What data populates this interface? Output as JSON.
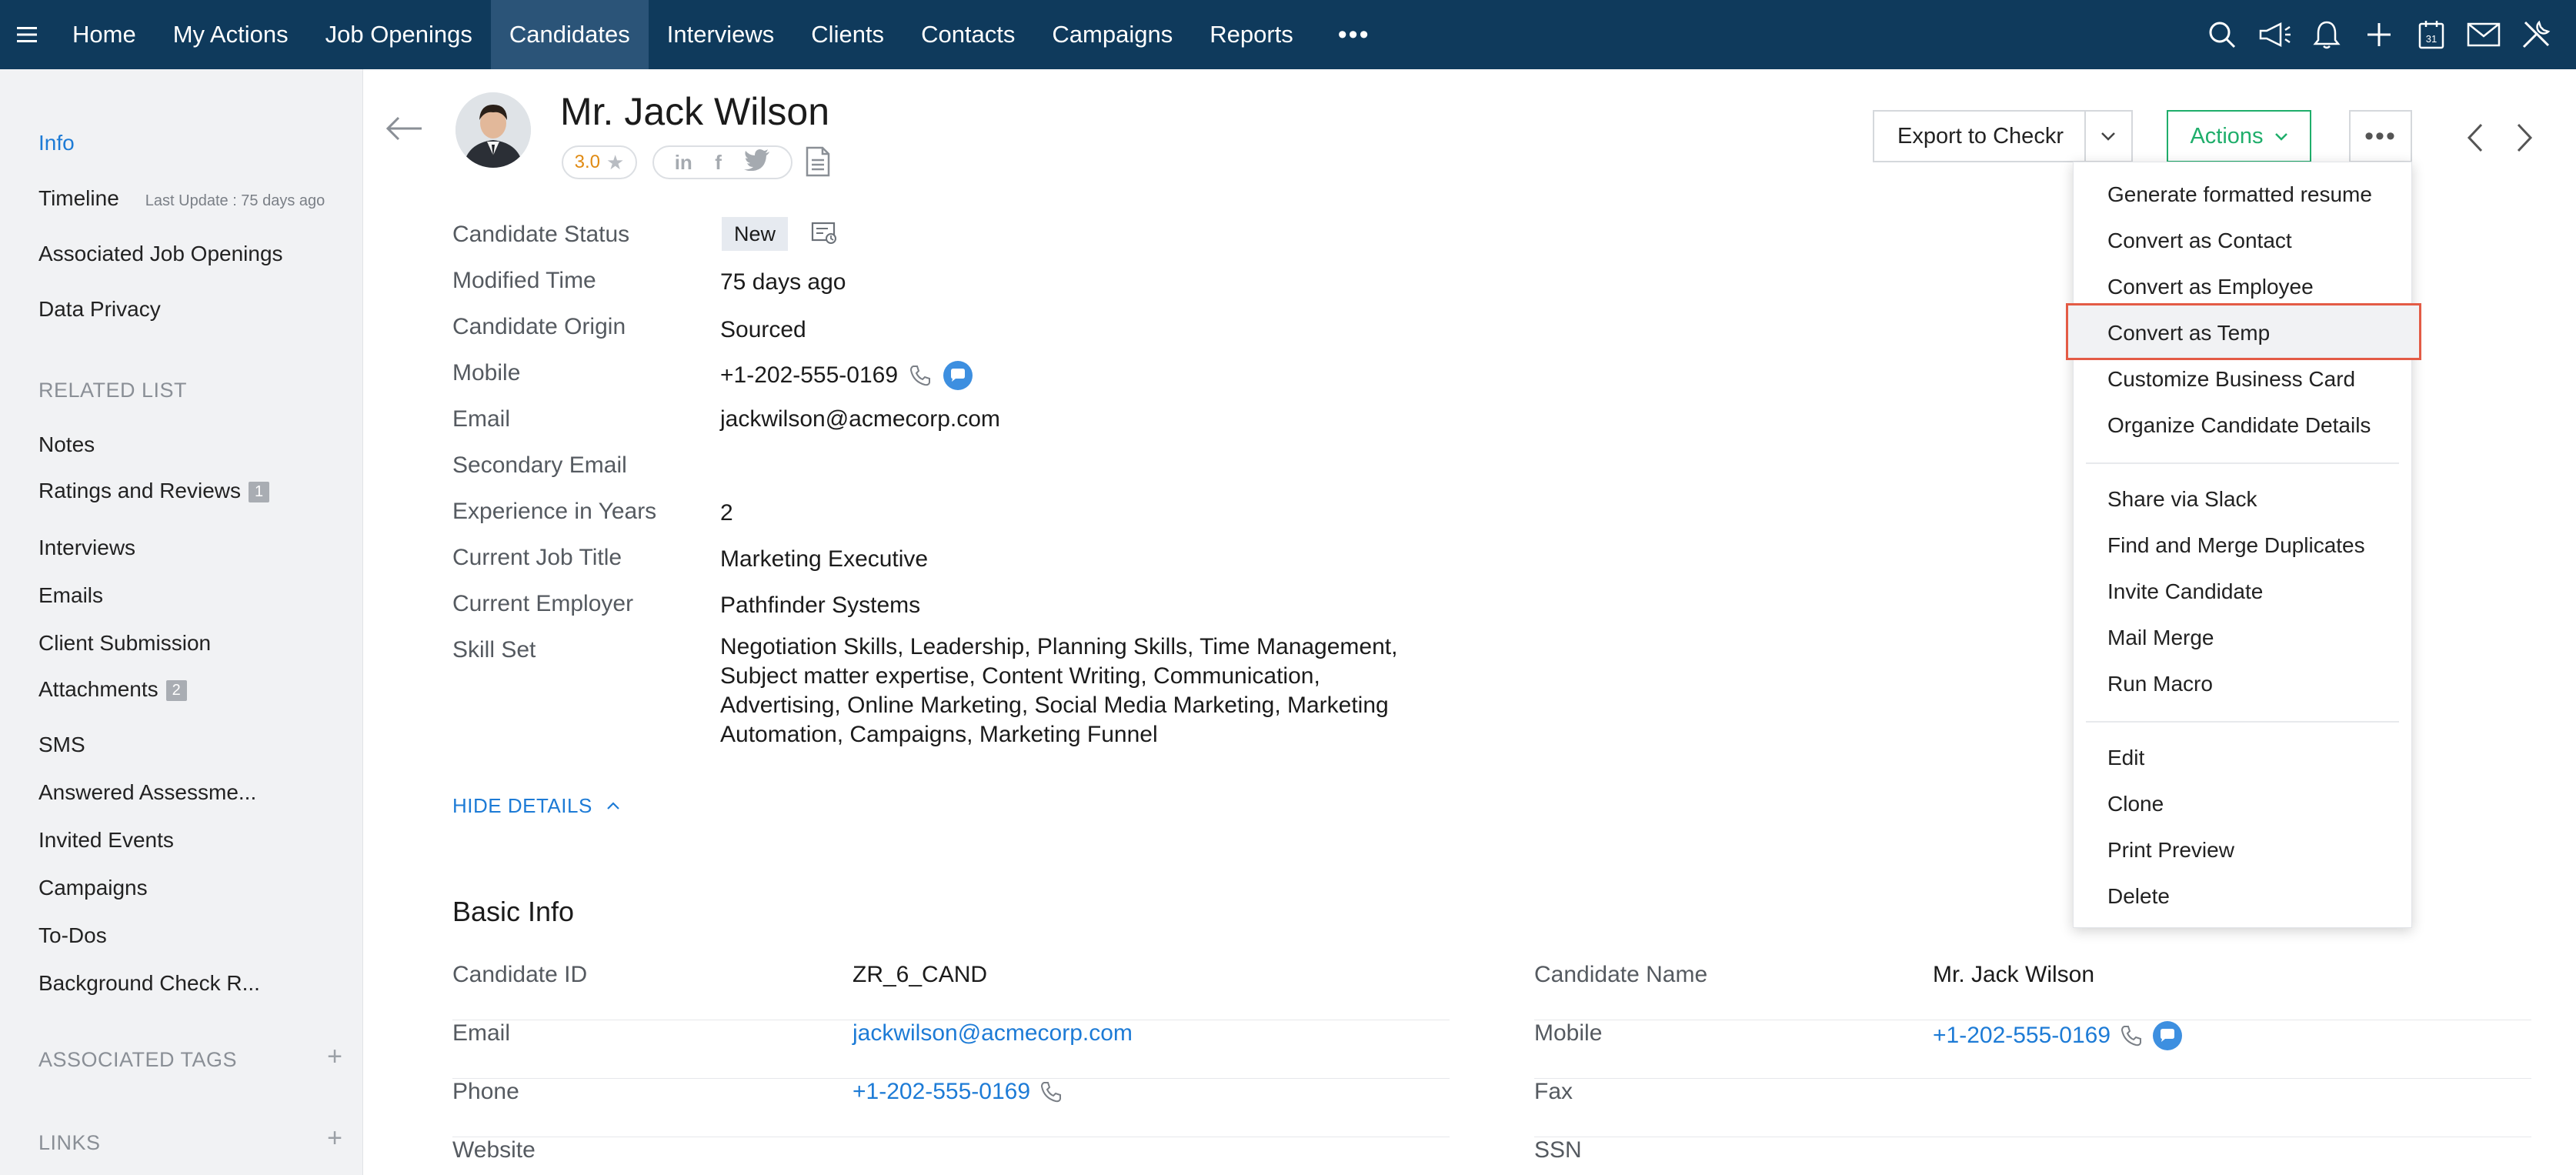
{
  "nav": {
    "items": [
      {
        "label": "Home",
        "active": false
      },
      {
        "label": "My Actions",
        "active": false
      },
      {
        "label": "Job Openings",
        "active": false
      },
      {
        "label": "Candidates",
        "active": true
      },
      {
        "label": "Interviews",
        "active": false
      },
      {
        "label": "Clients",
        "active": false
      },
      {
        "label": "Contacts",
        "active": false
      },
      {
        "label": "Campaigns",
        "active": false
      },
      {
        "label": "Reports",
        "active": false
      }
    ],
    "more_label": "•••",
    "right_icons": [
      "search-icon",
      "megaphone-icon",
      "bell-icon",
      "plus-icon",
      "calendar-icon",
      "mail-icon",
      "tools-icon"
    ],
    "calendar_day": "31",
    "colors": {
      "bar": "#0f3a5c",
      "active": "#2b5478"
    }
  },
  "sidebar": {
    "info": "Info",
    "timeline": "Timeline",
    "last_update": "Last Update : 75 days ago",
    "associated_job_openings": "Associated Job Openings",
    "data_privacy": "Data Privacy",
    "related_list_title": "RELATED LIST",
    "related": [
      {
        "label": "Notes",
        "badge": ""
      },
      {
        "label": "Ratings and Reviews",
        "badge": "1"
      },
      {
        "label": "Interviews",
        "badge": ""
      },
      {
        "label": "Emails",
        "badge": ""
      },
      {
        "label": "Client Submission",
        "badge": ""
      },
      {
        "label": "Attachments",
        "badge": "2"
      },
      {
        "label": "SMS",
        "badge": ""
      },
      {
        "label": "Answered Assessme...",
        "badge": ""
      },
      {
        "label": "Invited Events",
        "badge": ""
      },
      {
        "label": "Campaigns",
        "badge": ""
      },
      {
        "label": "To-Dos",
        "badge": ""
      },
      {
        "label": "Background Check R...",
        "badge": ""
      }
    ],
    "associated_tags": "ASSOCIATED TAGS",
    "links": "LINKS",
    "plus": "+"
  },
  "header": {
    "name": "Mr. Jack Wilson",
    "rating": "3.0",
    "star": "★",
    "social": [
      "in",
      "f"
    ],
    "export_label": "Export to Checkr",
    "actions_label": "Actions",
    "more_label": "•••",
    "accent": "#1fae6b"
  },
  "details": {
    "candidate_status": {
      "label": "Candidate Status",
      "value": "New"
    },
    "modified_time": {
      "label": "Modified Time",
      "value": "75 days ago"
    },
    "candidate_origin": {
      "label": "Candidate Origin",
      "value": "Sourced"
    },
    "mobile": {
      "label": "Mobile",
      "value": "+1-202-555-0169"
    },
    "email": {
      "label": "Email",
      "value": "jackwilson@acmecorp.com"
    },
    "secondary_email": {
      "label": "Secondary Email",
      "value": ""
    },
    "experience": {
      "label": "Experience in Years",
      "value": "2"
    },
    "job_title": {
      "label": "Current Job Title",
      "value": "Marketing Executive"
    },
    "employer": {
      "label": "Current Employer",
      "value": "Pathfinder Systems"
    },
    "skill_set": {
      "label": "Skill Set",
      "value": "Negotiation Skills, Leadership, Planning Skills, Time Management, Subject matter expertise, Content Writing, Communication, Advertising, Online Marketing, Social Media Marketing, Marketing Automation, Campaigns, Marketing Funnel"
    },
    "hide_details": "HIDE DETAILS"
  },
  "basic_info": {
    "title": "Basic Info",
    "left": [
      {
        "label": "Candidate ID",
        "value": "ZR_6_CAND",
        "link": false
      },
      {
        "label": "Email",
        "value": "jackwilson@acmecorp.com",
        "link": true
      },
      {
        "label": "Phone",
        "value": "+1-202-555-0169",
        "link": true
      },
      {
        "label": "Website",
        "value": "",
        "link": false
      }
    ],
    "right": [
      {
        "label": "Candidate Name",
        "value": "Mr. Jack Wilson",
        "link": false
      },
      {
        "label": "Mobile",
        "value": "+1-202-555-0169",
        "link": true
      },
      {
        "label": "Fax",
        "value": "",
        "link": false
      },
      {
        "label": "SSN",
        "value": "",
        "link": false
      }
    ]
  },
  "menu": {
    "group1": [
      "Generate formatted resume",
      "Convert as Contact",
      "Convert as Employee",
      "Convert as Temp",
      "Customize Business Card",
      "Organize Candidate Details"
    ],
    "group2": [
      "Share via Slack",
      "Find and Merge Duplicates",
      "Invite Candidate",
      "Mail Merge",
      "Run Macro"
    ],
    "group3": [
      "Edit",
      "Clone",
      "Print Preview",
      "Delete"
    ],
    "highlighted": "Convert as Temp",
    "highlight_color": "#e35b45"
  }
}
